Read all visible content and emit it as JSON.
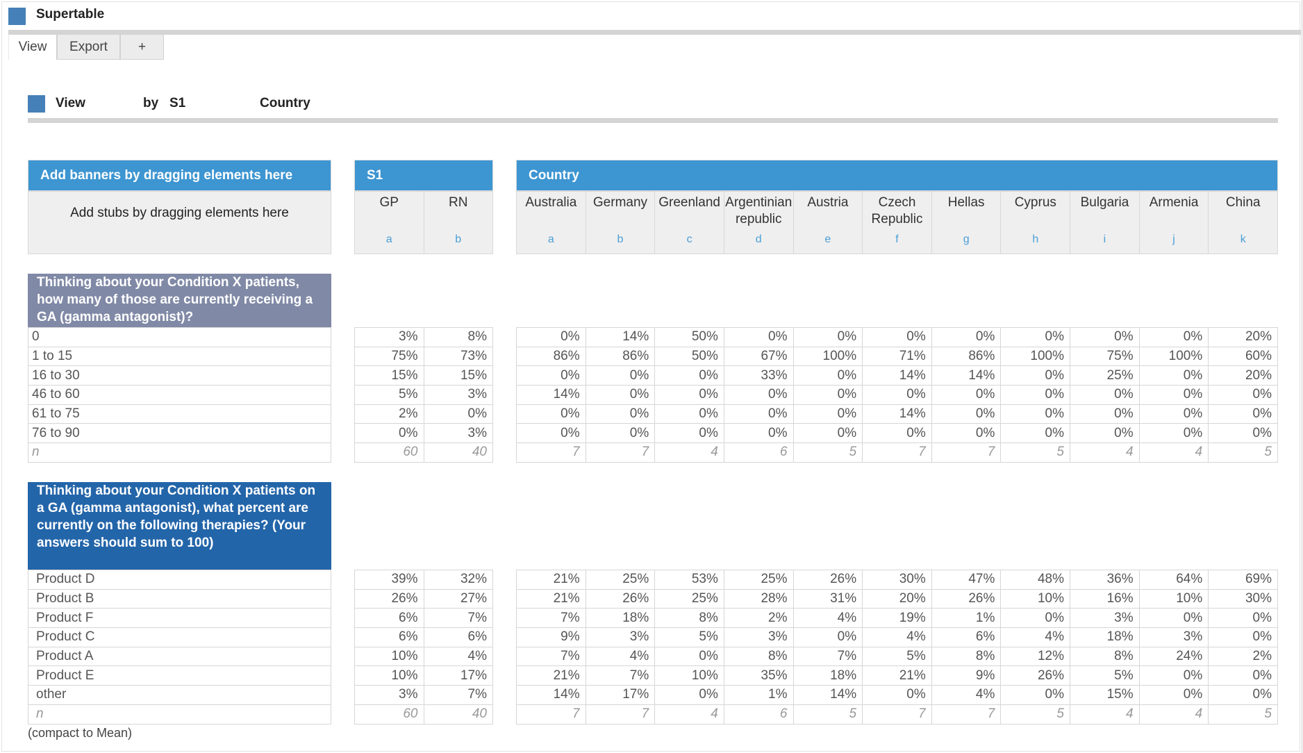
{
  "app": {
    "title": "Supertable",
    "accent_color": "#4580b8"
  },
  "tabs": [
    {
      "label": "View",
      "active": true
    },
    {
      "label": "Export",
      "active": false
    },
    {
      "label": "+",
      "active": false
    }
  ],
  "view_row": {
    "view_label": "View",
    "by_label": "by   S1",
    "country_label": "Country"
  },
  "banners": {
    "add_banner_text": "Add banners by dragging elements here",
    "add_stub_text": "Add stubs by dragging elements here",
    "header_color": "#3d95d1",
    "groups": [
      {
        "name": "S1",
        "columns": [
          {
            "label": "GP",
            "letter": "a"
          },
          {
            "label": "RN",
            "letter": "b"
          }
        ]
      },
      {
        "name": "Country",
        "columns": [
          {
            "label": "Australia",
            "letter": "a"
          },
          {
            "label": "Germany",
            "letter": "b"
          },
          {
            "label": "Greenland",
            "letter": "c"
          },
          {
            "label": "Argentinian republic",
            "letter": "d"
          },
          {
            "label": "Austria",
            "letter": "e"
          },
          {
            "label": "Czech Republic",
            "letter": "f"
          },
          {
            "label": "Hellas",
            "letter": "g"
          },
          {
            "label": "Cyprus",
            "letter": "h"
          },
          {
            "label": "Bulgaria",
            "letter": "i"
          },
          {
            "label": "Armenia",
            "letter": "j"
          },
          {
            "label": "China",
            "letter": "k"
          }
        ]
      }
    ]
  },
  "questions": [
    {
      "title": "Thinking about your Condition X patients, how many of those are currently receiving a GA (gamma antagonist)?",
      "header_color": "#8089a6",
      "rows": [
        {
          "label": "0",
          "s1": [
            "3%",
            "8%"
          ],
          "country": [
            "0%",
            "14%",
            "50%",
            "0%",
            "0%",
            "0%",
            "0%",
            "0%",
            "0%",
            "0%",
            "20%"
          ]
        },
        {
          "label": "1 to 15",
          "s1": [
            "75%",
            "73%"
          ],
          "country": [
            "86%",
            "86%",
            "50%",
            "67%",
            "100%",
            "71%",
            "86%",
            "100%",
            "75%",
            "100%",
            "60%"
          ]
        },
        {
          "label": "16 to 30",
          "s1": [
            "15%",
            "15%"
          ],
          "country": [
            "0%",
            "0%",
            "0%",
            "33%",
            "0%",
            "14%",
            "14%",
            "0%",
            "25%",
            "0%",
            "20%"
          ]
        },
        {
          "label": "46 to 60",
          "s1": [
            "5%",
            "3%"
          ],
          "country": [
            "14%",
            "0%",
            "0%",
            "0%",
            "0%",
            "0%",
            "0%",
            "0%",
            "0%",
            "0%",
            "0%"
          ]
        },
        {
          "label": "61 to 75",
          "s1": [
            "2%",
            "0%"
          ],
          "country": [
            "0%",
            "0%",
            "0%",
            "0%",
            "0%",
            "14%",
            "0%",
            "0%",
            "0%",
            "0%",
            "0%"
          ]
        },
        {
          "label": "76 to 90",
          "s1": [
            "0%",
            "3%"
          ],
          "country": [
            "0%",
            "0%",
            "0%",
            "0%",
            "0%",
            "0%",
            "0%",
            "0%",
            "0%",
            "0%",
            "0%"
          ]
        },
        {
          "label": "n",
          "is_n": true,
          "s1": [
            "60",
            "40"
          ],
          "country": [
            "7",
            "7",
            "4",
            "6",
            "5",
            "7",
            "7",
            "5",
            "4",
            "4",
            "5"
          ]
        }
      ]
    },
    {
      "title": "Thinking about your Condition X patients on a GA (gamma antagonist), what percent are currently on the following therapies? (Your answers should sum to 100)",
      "header_color": "#2365a9",
      "rows": [
        {
          "label": "Product D",
          "s1": [
            "39%",
            "32%"
          ],
          "country": [
            "21%",
            "25%",
            "53%",
            "25%",
            "26%",
            "30%",
            "47%",
            "48%",
            "36%",
            "64%",
            "69%"
          ]
        },
        {
          "label": "Product B",
          "s1": [
            "26%",
            "27%"
          ],
          "country": [
            "21%",
            "26%",
            "25%",
            "28%",
            "31%",
            "20%",
            "26%",
            "10%",
            "16%",
            "10%",
            "30%"
          ]
        },
        {
          "label": "Product F",
          "s1": [
            "6%",
            "7%"
          ],
          "country": [
            "7%",
            "18%",
            "8%",
            "2%",
            "4%",
            "19%",
            "1%",
            "0%",
            "3%",
            "0%",
            "0%"
          ]
        },
        {
          "label": "Product C",
          "s1": [
            "6%",
            "6%"
          ],
          "country": [
            "9%",
            "3%",
            "5%",
            "3%",
            "0%",
            "4%",
            "6%",
            "4%",
            "18%",
            "3%",
            "0%"
          ]
        },
        {
          "label": "Product A",
          "s1": [
            "10%",
            "4%"
          ],
          "country": [
            "7%",
            "4%",
            "0%",
            "8%",
            "7%",
            "5%",
            "8%",
            "12%",
            "8%",
            "24%",
            "2%"
          ]
        },
        {
          "label": "Product E",
          "s1": [
            "10%",
            "17%"
          ],
          "country": [
            "21%",
            "7%",
            "10%",
            "35%",
            "18%",
            "21%",
            "9%",
            "26%",
            "5%",
            "0%",
            "0%"
          ]
        },
        {
          "label": "other",
          "s1": [
            "3%",
            "7%"
          ],
          "country": [
            "14%",
            "17%",
            "0%",
            "1%",
            "14%",
            "0%",
            "4%",
            "0%",
            "15%",
            "0%",
            "0%"
          ]
        },
        {
          "label": "n",
          "is_n": true,
          "s1": [
            "60",
            "40"
          ],
          "country": [
            "7",
            "7",
            "4",
            "6",
            "5",
            "7",
            "7",
            "5",
            "4",
            "4",
            "5"
          ]
        }
      ]
    }
  ],
  "footer": {
    "compact_note": "(compact to Mean)"
  }
}
